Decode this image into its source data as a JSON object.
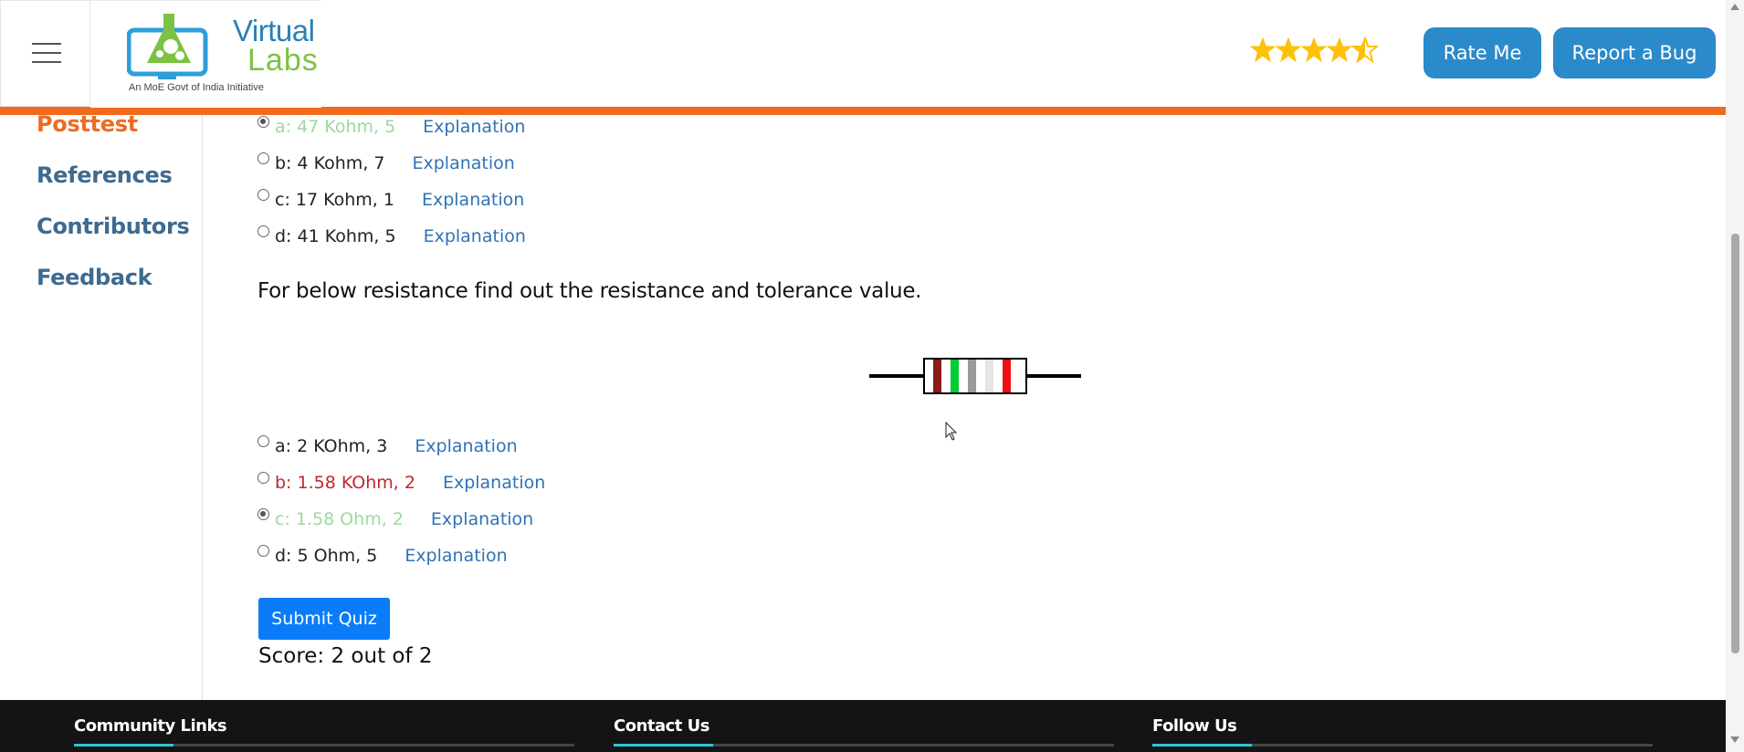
{
  "header": {
    "logo_word1": "Virtual",
    "logo_word2": "Labs",
    "logo_tagline": "An MoE Govt of India Initiative",
    "rating": 4.5,
    "rate_button": "Rate Me",
    "bug_button": "Report a Bug"
  },
  "sidebar": {
    "items": [
      {
        "label": "Posttest",
        "active": true
      },
      {
        "label": "References"
      },
      {
        "label": "Contributors"
      },
      {
        "label": "Feedback"
      }
    ]
  },
  "quiz": {
    "q1_options": [
      {
        "text": "a: 47 Kohm, 5",
        "state": "correct",
        "checked": true,
        "explain": "Explanation"
      },
      {
        "text": "b: 4 Kohm, 7",
        "state": "",
        "checked": false,
        "explain": "Explanation"
      },
      {
        "text": "c: 17 Kohm, 1",
        "state": "",
        "checked": false,
        "explain": "Explanation"
      },
      {
        "text": "d: 41 Kohm, 5",
        "state": "",
        "checked": false,
        "explain": "Explanation"
      }
    ],
    "q2_text": "For below resistance find out the resistance and tolerance value.",
    "resistor_bands": [
      "#8b1a1a",
      "#00cc33",
      "#9a9a9a",
      "#e5e5e5",
      "#ee1111"
    ],
    "q2_options": [
      {
        "text": "a: 2 KOhm, 3",
        "state": "",
        "checked": false,
        "explain": "Explanation"
      },
      {
        "text": "b: 1.58 KOhm, 2",
        "state": "wrong",
        "checked": false,
        "explain": "Explanation"
      },
      {
        "text": "c: 1.58 Ohm, 2",
        "state": "correct",
        "checked": true,
        "explain": "Explanation"
      },
      {
        "text": "d: 5 Ohm, 5",
        "state": "",
        "checked": false,
        "explain": "Explanation"
      }
    ],
    "submit_label": "Submit Quiz",
    "score_text": "Score: 2 out of 2"
  },
  "footer": {
    "community": "Community Links",
    "contact": "Contact Us",
    "follow": "Follow Us"
  },
  "colors": {
    "accent_orange": "#f26b1d",
    "button_blue": "#2b8ac9",
    "correct_green": "#9ed99e",
    "wrong_red": "#c0282d",
    "link_blue": "#2f73b5"
  }
}
